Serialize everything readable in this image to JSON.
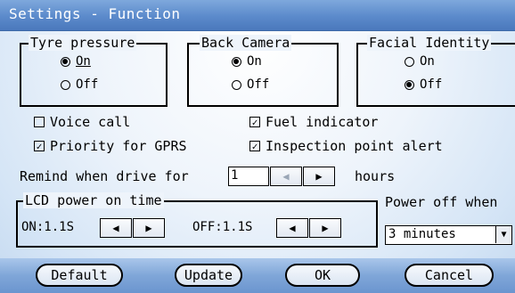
{
  "window": {
    "title": "Settings - Function"
  },
  "tyre_pressure": {
    "label": "Tyre pressure",
    "options": [
      "On",
      "Off"
    ],
    "selected": "On"
  },
  "back_camera": {
    "label": "Back Camera",
    "options": [
      "On",
      "Off"
    ],
    "selected": "On"
  },
  "facial_identity": {
    "label": "Facial Identity",
    "options": [
      "On",
      "Off"
    ],
    "selected": "Off"
  },
  "checkboxes": {
    "voice_call": {
      "label": "Voice call",
      "checked": false
    },
    "fuel_indicator": {
      "label": "Fuel indicator",
      "checked": true
    },
    "priority_gprs": {
      "label": "Priority for GPRS",
      "checked": true
    },
    "inspection_alert": {
      "label": "Inspection point alert",
      "checked": true
    }
  },
  "remind": {
    "label_before": "Remind when drive for",
    "value": "1",
    "label_after": "hours"
  },
  "lcd": {
    "label": "LCD power on time",
    "on_label": "ON:",
    "on_value": "1.1S",
    "off_label": "OFF:",
    "off_value": "1.1S"
  },
  "power_off": {
    "label": "Power off when",
    "value": "3 minutes"
  },
  "arrows": {
    "left": "◀",
    "right": "▶",
    "down": "▼",
    "check": "✓"
  },
  "buttons": {
    "default": "Default",
    "update": "Update",
    "ok": "OK",
    "cancel": "Cancel"
  },
  "colors": {
    "titlebar": "#5b8acb",
    "bottombar": "#7fa6d8",
    "background": "#eef4fb"
  }
}
